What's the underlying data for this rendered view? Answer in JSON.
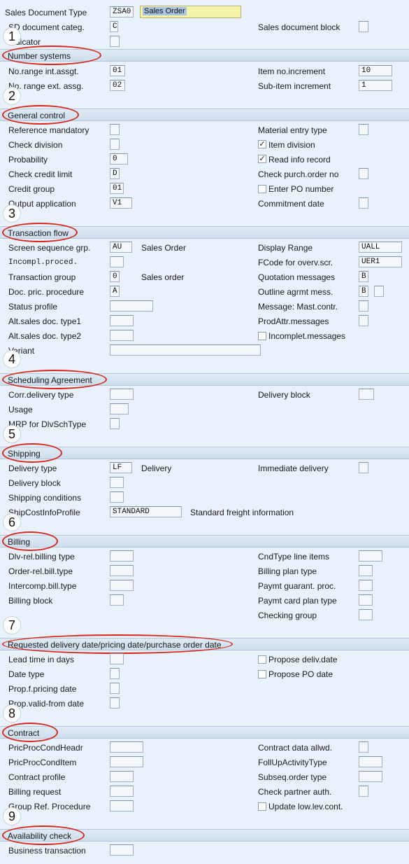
{
  "header": {
    "doc_type_label": "Sales Document Type",
    "doc_type_code": "ZSA0",
    "doc_type_desc": "Sales Order",
    "sd_categ_label": "SD document categ.",
    "sd_categ_value": "C",
    "indicator_label": "Indicator",
    "doc_block_label": "Sales document block"
  },
  "markers": [
    "1",
    "2",
    "3",
    "4",
    "5",
    "6",
    "7",
    "8",
    "9"
  ],
  "sections": {
    "number_systems": "Number systems",
    "general_control": "General control",
    "transaction_flow": "Transaction flow",
    "scheduling": "Scheduling Agreement",
    "shipping": "Shipping",
    "billing": "Billing",
    "requested": "Requested delivery date/pricing date/purchase order date",
    "contract": "Contract",
    "availability": "Availability check"
  },
  "number_systems": {
    "int_label": "No.range int.assgt.",
    "int_value": "01",
    "ext_label": "No. range ext. assg.",
    "ext_value": "02",
    "item_inc_label": "Item no.increment",
    "item_inc_value": "10",
    "sub_inc_label": "Sub-item increment",
    "sub_inc_value": "1"
  },
  "general_control": {
    "ref_mand": "Reference mandatory",
    "check_div": "Check division",
    "probability": "Probability",
    "probability_value": "0",
    "check_credit": "Check credit limit",
    "check_credit_value": "D",
    "credit_group": "Credit group",
    "credit_group_value": "01",
    "output_app": "Output application",
    "output_app_value": "V1",
    "mat_entry": "Material entry type",
    "item_div": "Item division",
    "item_div_checked": true,
    "read_info": "Read info record",
    "read_info_checked": true,
    "check_po": "Check purch.order no",
    "enter_po": "Enter PO number",
    "enter_po_checked": false,
    "commit_date": "Commitment  date"
  },
  "transaction_flow": {
    "screen_seq": "Screen sequence grp.",
    "screen_seq_value": "AU",
    "screen_seq_desc": "Sales Order",
    "incompl": "Incompl.proced.",
    "trans_group": "Transaction group",
    "trans_group_value": "0",
    "trans_group_desc": "Sales order",
    "doc_pric": "Doc. pric. procedure",
    "doc_pric_value": "A",
    "status_profile": "Status profile",
    "alt_type1": "Alt.sales doc. type1",
    "alt_type2": "Alt.sales doc. type2",
    "variant": "Variant",
    "display_range": "Display Range",
    "display_range_value": "UALL",
    "fcode": "FCode for overv.scr.",
    "fcode_value": "UER1",
    "quotation": "Quotation messages",
    "quotation_value": "B",
    "outline": "Outline agrmt mess.",
    "outline_value": "B",
    "mast_contr": "Message: Mast.contr.",
    "prodattr": "ProdAttr.messages",
    "incomplet": "Incomplet.messages",
    "incomplet_checked": false
  },
  "scheduling": {
    "corr_delivery": "Corr.delivery type",
    "usage": "Usage",
    "mrp": "MRP for DlvSchType",
    "delivery_block": "Delivery block"
  },
  "shipping": {
    "delivery_type": "Delivery type",
    "delivery_type_value": "LF",
    "delivery_type_desc": "Delivery",
    "delivery_block": "Delivery block",
    "shipping_cond": "Shipping conditions",
    "shipcost": "ShipCostInfoProfile",
    "shipcost_value": "STANDARD",
    "shipcost_desc": "Standard freight information",
    "immediate": "Immediate delivery"
  },
  "billing": {
    "dlv_rel": "Dlv-rel.billing type",
    "order_rel": "Order-rel.bill.type",
    "intercomp": "Intercomp.bill.type",
    "billing_block": "Billing block",
    "cndtype": "CndType line items",
    "plan_type": "Billing plan type",
    "paymt_guar": "Paymt guarant. proc.",
    "paymt_card": "Paymt card plan type",
    "checking_group": "Checking group"
  },
  "requested": {
    "lead_time": "Lead time in days",
    "date_type": "Date type",
    "prop_pricing": "Prop.f.pricing date",
    "prop_valid": "Prop.valid-from date",
    "propose_deliv": "Propose deliv.date",
    "propose_deliv_checked": false,
    "propose_po": "Propose PO date",
    "propose_po_checked": false
  },
  "contract": {
    "pric_headr": "PricProcCondHeadr",
    "pric_item": "PricProcCondItem",
    "contract_profile": "Contract profile",
    "billing_request": "Billing request",
    "group_ref": "Group Ref. Procedure",
    "data_allwd": "Contract data allwd.",
    "follup": "FollUpActivityType",
    "subseq": "Subseq.order type",
    "check_partner": "Check partner auth.",
    "update_low": "Update low.lev.cont.",
    "update_low_checked": false
  },
  "availability": {
    "business_trans": "Business transaction"
  },
  "colors": {
    "background": "#e9f2fb",
    "annotation": "#d8281e",
    "highlight": "#f4f3a8"
  }
}
